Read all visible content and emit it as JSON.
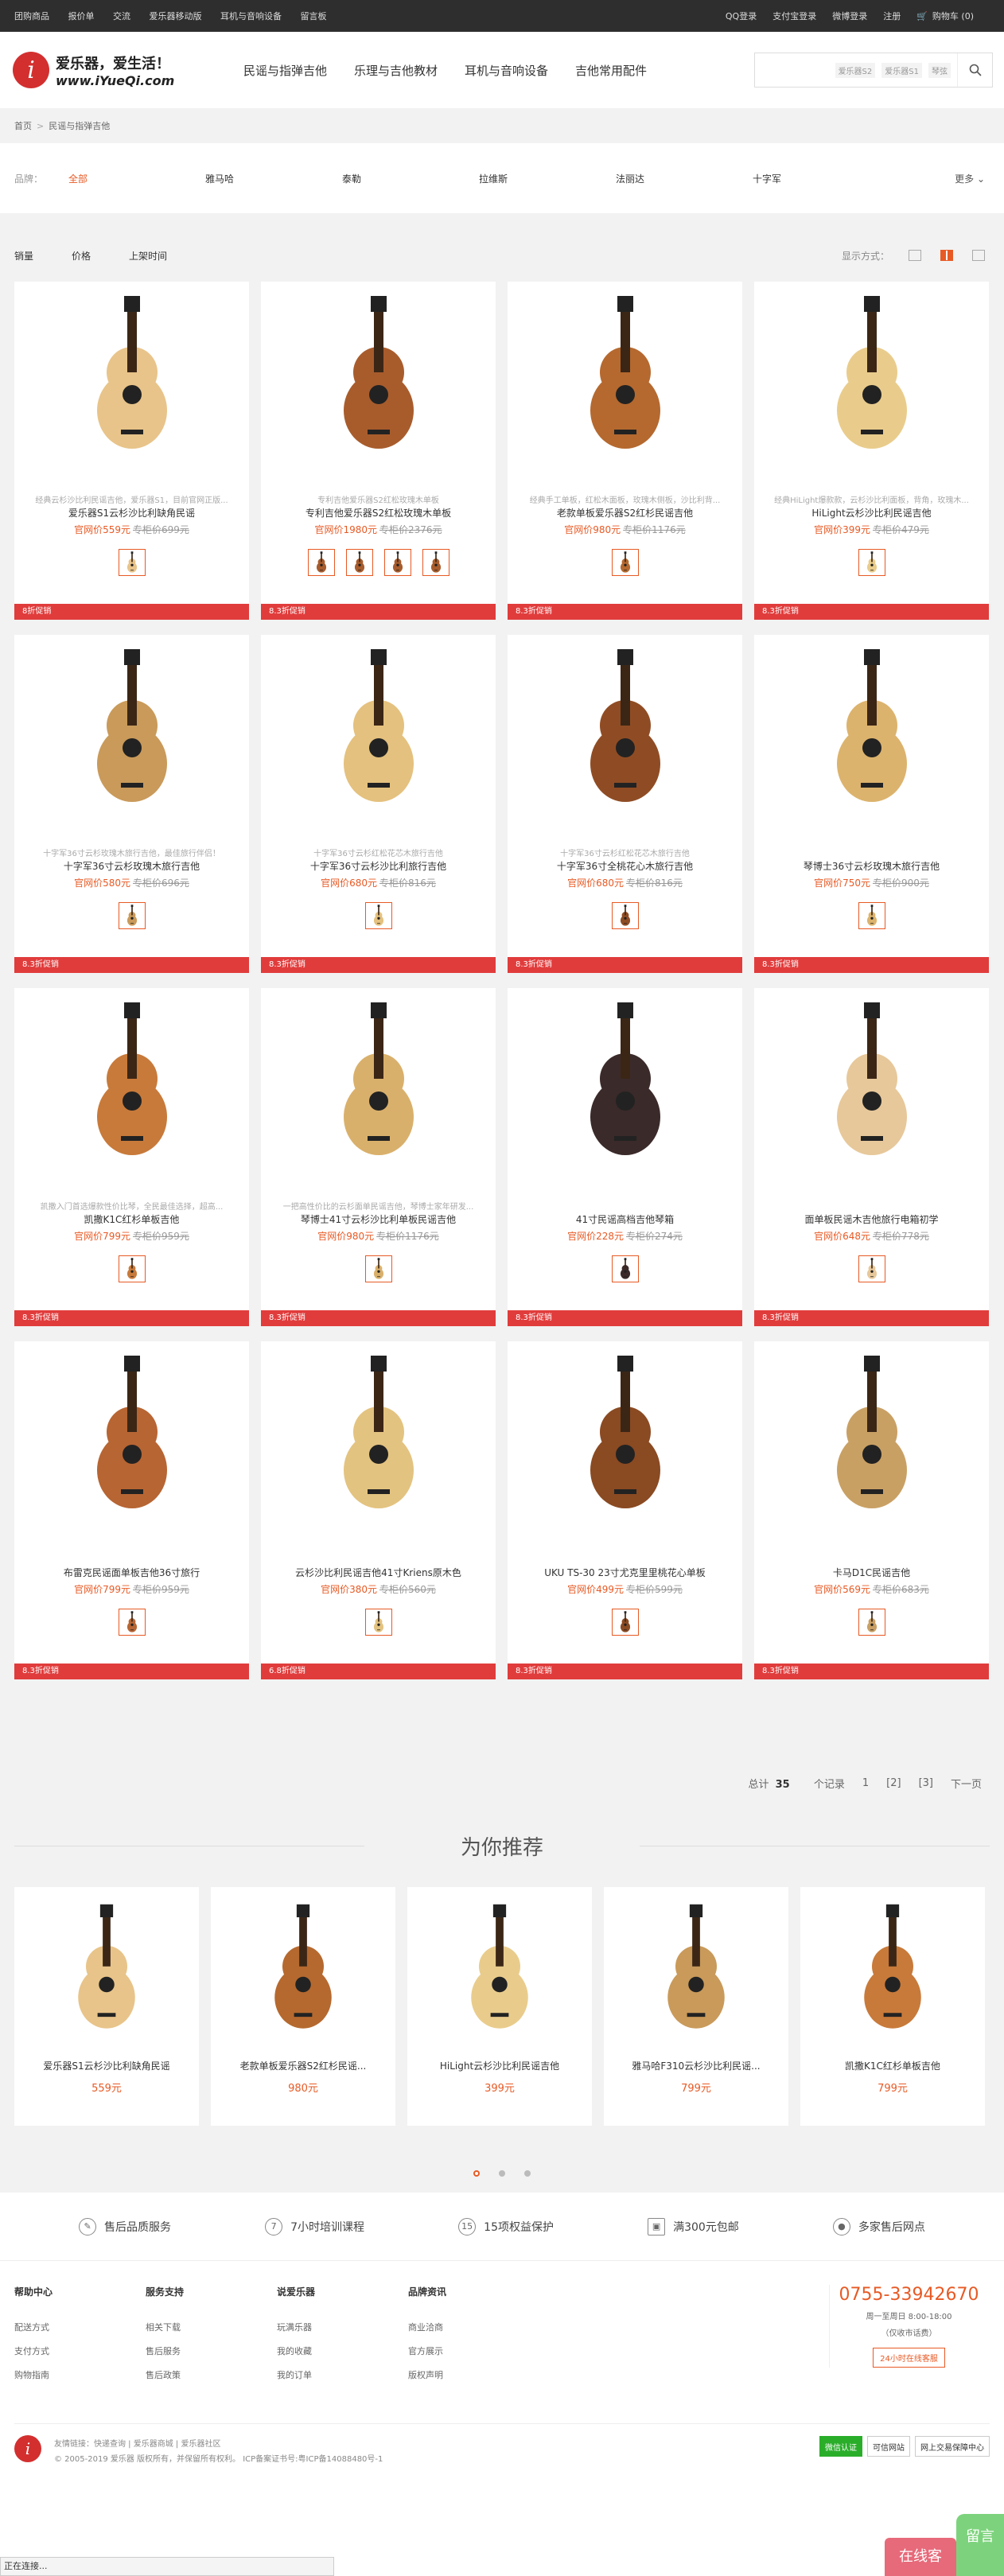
{
  "topbar": {
    "left": [
      "团购商品",
      "报价单",
      "交流",
      "爱乐器移动版",
      "耳机与音响设备",
      "留言板"
    ],
    "right": [
      "QQ登录",
      "支付宝登录",
      "微博登录",
      "注册"
    ],
    "cart": "购物车 (0)"
  },
  "logo": {
    "mark": "i",
    "line1": "爱乐器，爱生活！",
    "line2": "www.iYueQi.com"
  },
  "mainnav": [
    "民谣与指弹吉他",
    "乐理与吉他教材",
    "耳机与音响设备",
    "吉他常用配件"
  ],
  "search": {
    "tags": [
      "爱乐器S2",
      "爱乐器S1",
      "琴弦"
    ]
  },
  "breadcrumb": {
    "home": "首页",
    "current": "民谣与指弹吉他"
  },
  "brands": {
    "label": "品牌：",
    "items": [
      "全部",
      "雅马哈",
      "泰勒",
      "拉维斯",
      "法丽达",
      "十字军"
    ],
    "more": "更多"
  },
  "sort": {
    "items": [
      "销量",
      "价格",
      "上架时间"
    ],
    "view_label": "显示方式："
  },
  "products": [
    {
      "desc": "经典云杉沙比利民谣吉他，爱乐器S1，目前官网正版...",
      "name": "爱乐器S1云杉沙比利缺角民谣",
      "price": "官网价559元",
      "old": "专柜价699元",
      "promo": "8折促销",
      "thumbs": 1
    },
    {
      "desc": "专利吉他爱乐器S2红松玫瑰木单板",
      "name": "专利吉他爱乐器S2红松玫瑰木单板",
      "price": "官网价1980元",
      "old": "专柜价2376元",
      "promo": "8.3折促销",
      "thumbs": 4
    },
    {
      "desc": "经典手工单板，红松木面板，玫瑰木侧板，沙比利背...",
      "name": "老款单板爱乐器S2红杉民谣吉他",
      "price": "官网价980元",
      "old": "专柜价1176元",
      "promo": "8.3折促销",
      "thumbs": 1
    },
    {
      "desc": "经典HiLight爆款款，云杉沙比利面板，背角，玫瑰木...",
      "name": "HiLight云杉沙比利民谣吉他",
      "price": "官网价399元",
      "old": "专柜价479元",
      "promo": "8.3折促销",
      "thumbs": 1
    },
    {
      "desc": "十字军36寸云杉玫瑰木旅行吉他，最佳旅行伴侣！",
      "name": "十字军36寸云杉玫瑰木旅行吉他",
      "price": "官网价580元",
      "old": "专柜价696元",
      "promo": "8.3折促销",
      "thumbs": 1
    },
    {
      "desc": "十字军36寸云杉红松花芯木旅行吉他",
      "name": "十字军36寸云杉沙比利旅行吉他",
      "price": "官网价680元",
      "old": "专柜价816元",
      "promo": "8.3折促销",
      "thumbs": 1
    },
    {
      "desc": "十字军36寸云杉红松花芯木旅行吉他",
      "name": "十字军36寸全桃花心木旅行吉他",
      "price": "官网价680元",
      "old": "专柜价816元",
      "promo": "8.3折促销",
      "thumbs": 1
    },
    {
      "desc": "",
      "name": "琴博士36寸云杉玫瑰木旅行吉他",
      "price": "官网价750元",
      "old": "专柜价900元",
      "promo": "8.3折促销",
      "thumbs": 1
    },
    {
      "desc": "凯撒入门首选爆款性价比琴，全民最佳选择，超高...",
      "name": "凯撒K1C红杉单板吉他",
      "price": "官网价799元",
      "old": "专柜价959元",
      "promo": "8.3折促销",
      "thumbs": 1
    },
    {
      "desc": "一把高性价比的云杉面单民谣吉他，琴博士家年研发...",
      "name": "琴博士41寸云杉沙比利单板民谣吉他",
      "price": "官网价980元",
      "old": "专柜价1176元",
      "promo": "8.3折促销",
      "thumbs": 1
    },
    {
      "desc": "",
      "name": "41寸民谣高档吉他琴箱",
      "price": "官网价228元",
      "old": "专柜价274元",
      "promo": "8.3折促销",
      "thumbs": 1
    },
    {
      "desc": "",
      "name": "面单板民谣木吉他旅行电箱初学",
      "price": "官网价648元",
      "old": "专柜价778元",
      "promo": "8.3折促销",
      "thumbs": 1
    },
    {
      "desc": "",
      "name": "布雷克民谣面单板吉他36寸旅行",
      "price": "官网价799元",
      "old": "专柜价959元",
      "promo": "8.3折促销",
      "thumbs": 1
    },
    {
      "desc": "",
      "name": "云杉沙比利民谣吉他41寸Kriens原木色",
      "price": "官网价380元",
      "old": "专柜价560元",
      "promo": "6.8折促销",
      "thumbs": 1
    },
    {
      "desc": "",
      "name": "UKU TS-30 23寸尤克里里桃花心单板",
      "price": "官网价499元",
      "old": "专柜价599元",
      "promo": "8.3折促销",
      "thumbs": 1
    },
    {
      "desc": "",
      "name": "卡马D1C民谣吉他",
      "price": "官网价569元",
      "old": "专柜价683元",
      "promo": "8.3折促销",
      "thumbs": 1
    }
  ],
  "pager": {
    "total_prefix": "总计",
    "total": "35",
    "total_suffix": "个记录",
    "pages": [
      "1",
      "[2]",
      "[3]"
    ],
    "next": "下一页"
  },
  "recommend": {
    "title": "为你推荐",
    "items": [
      {
        "name": "爱乐器S1云杉沙比利缺角民谣",
        "price": "559元"
      },
      {
        "name": "老款单板爱乐器S2红杉民谣...",
        "price": "980元"
      },
      {
        "name": "HiLight云杉沙比利民谣吉他",
        "price": "399元"
      },
      {
        "name": "雅马哈F310云杉沙比利民谣...",
        "price": "799元"
      },
      {
        "name": "凯撒K1C红杉单板吉他",
        "price": "799元"
      }
    ]
  },
  "services": [
    "售后品质服务",
    "7小时培训课程",
    "15项权益保护",
    "满300元包邮",
    "多家售后网点"
  ],
  "footer_cols": [
    {
      "title": "帮助中心",
      "items": [
        "配送方式",
        "支付方式",
        "购物指南"
      ]
    },
    {
      "title": "服务支持",
      "items": [
        "相关下载",
        "售后服务",
        "售后政策"
      ]
    },
    {
      "title": "说爱乐器",
      "items": [
        "玩满乐器",
        "我的收藏",
        "我的订单"
      ]
    },
    {
      "title": "品牌资讯",
      "items": [
        "商业洽商",
        "官方展示",
        "版权声明"
      ]
    }
  ],
  "hotline": {
    "number": "0755-33942670",
    "hours": "周一至周日 8:00-18:00",
    "note": "（仅收市话费）",
    "button": "24小时在线客服"
  },
  "copyright": {
    "links": "友情链接：快递查询 | 爱乐器商城 | 爱乐器社区",
    "text": "© 2005-2019 爱乐器 版权所有，并保留所有权利。 ICP备案证书号:粤ICP备14088480号-1"
  },
  "certs": [
    "微信认证",
    "可信网站",
    "网上交易保障中心"
  ],
  "status": "正在连接...",
  "widgets": {
    "online": "在线客",
    "message": "留言"
  }
}
